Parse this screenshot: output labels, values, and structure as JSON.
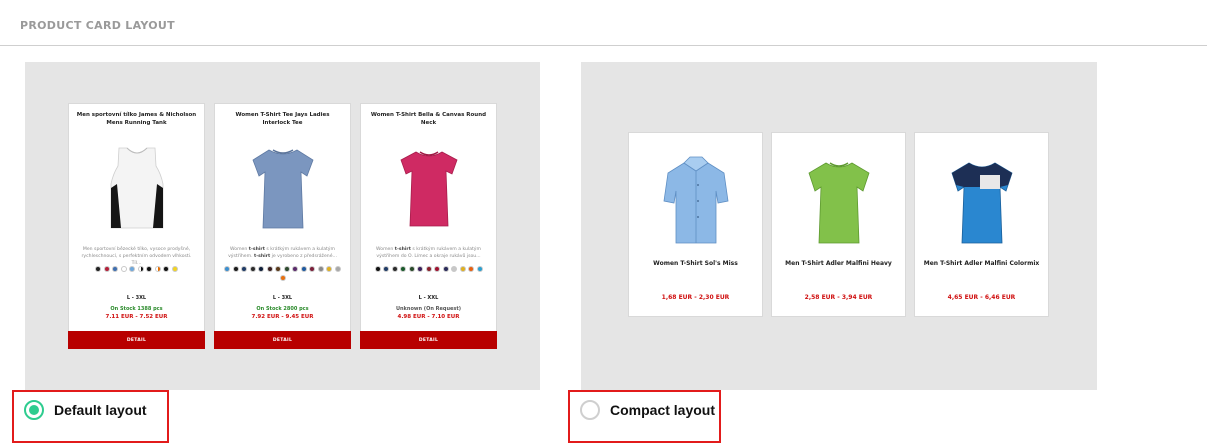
{
  "section": {
    "title": "PRODUCT CARD LAYOUT"
  },
  "colors": {
    "accent_red": "#b80000",
    "price_red": "#d01010",
    "radio_checked": "#2ecc8f",
    "highlight_border": "#e21b1b"
  },
  "default_layout": {
    "label": "Default layout",
    "selected": true,
    "cards": [
      {
        "title": "Men sportovní tílko James & Nicholson Mens Running Tank",
        "description": "Men sportovní bězecké tílko, vysoce prodyšné, rychleschnoucí, s perfektním odvodem vlhkosti. Tíl...",
        "swatches": [
          "#222222",
          "#b51f3a",
          "#3f6fb0",
          "#ffffff",
          "#6fa8dc",
          "#ffffff",
          "#111111",
          "#ffffff",
          "#e76f00",
          "#111111",
          "#f2d422"
        ],
        "sizes": "L - 3XL",
        "stock": "On Stock 1388 pcs",
        "price": "7.11 EUR - 7.52 EUR",
        "button": "DETAIL",
        "image_icon": "tank-top-icon"
      },
      {
        "title": "Women T-Shirt Tee Jays Ladies Interlock Tee",
        "description_prefix": "Women ",
        "description_bold": "t-shirt",
        "description_mid": " s krátkým rukávem a kulatým výstřihem. ",
        "description_bold2": "t-shirt",
        "description_suffix": " je vyrobeno z předsrážené...",
        "swatches": [
          "#3b8fd0",
          "#1a1a1a",
          "#1f3b66",
          "#2a2a2a",
          "#0f1f3a",
          "#3a1f1f",
          "#5a3a1a",
          "#2d4a2d",
          "#5b2a6b",
          "#1f5aa0",
          "#7a1f3a",
          "#8a8a8a",
          "#e0b020",
          "#a8a8a8",
          "#e87010"
        ],
        "sizes": "L - 3XL",
        "stock": "On Stock 2800 pcs",
        "price": "7.92 EUR - 9.45 EUR",
        "button": "DETAIL",
        "image_icon": "womens-tshirt-blue-icon"
      },
      {
        "title": "Women T-Shirt Bella & Canvas Round Neck",
        "description_prefix": "Women ",
        "description_bold": "t-shirt",
        "description_suffix": " s krátkým rukávem a kulatým výstřihem do O. Límec a okraje rukávů jsou...",
        "swatches": [
          "#111111",
          "#1f3b66",
          "#2a2a2a",
          "#1a5a2a",
          "#2a4a2a",
          "#3a1f5a",
          "#8a1f2a",
          "#a01030",
          "#2a2a5a",
          "#c8c8c8",
          "#e0b020",
          "#e86010",
          "#2aa0d0"
        ],
        "sizes": "L - XXL",
        "stock": "Unknown (On Request)",
        "price": "4.98 EUR - 7.10 EUR",
        "button": "DETAIL",
        "image_icon": "womens-tshirt-pink-icon"
      }
    ]
  },
  "compact_layout": {
    "label": "Compact layout",
    "selected": false,
    "cards": [
      {
        "title": "Women T-Shirt Sol's Miss",
        "price": "1,68 EUR - 2,30 EUR",
        "image_icon": "blue-shirt-icon"
      },
      {
        "title": "Men T-Shirt Adler Malfini Heavy",
        "price": "2,58 EUR - 3,94 EUR",
        "image_icon": "green-tshirt-icon"
      },
      {
        "title": "Men T-Shirt Adler Malfini Colormix",
        "price": "4,65 EUR - 6,46 EUR",
        "image_icon": "colormix-tshirt-icon"
      }
    ]
  }
}
